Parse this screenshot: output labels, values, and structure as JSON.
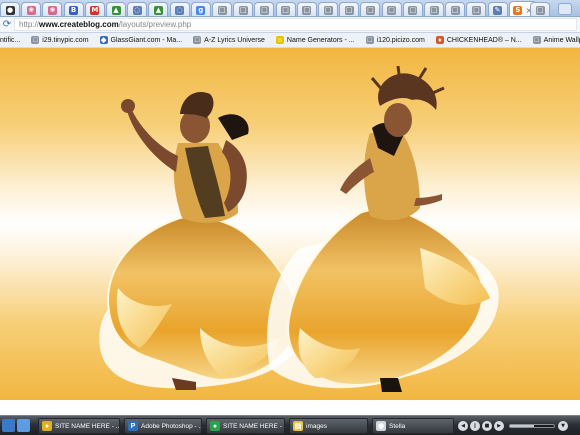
{
  "browser": {
    "tabs": [
      {
        "icon": "favicon-dark-circle",
        "color": "#333333",
        "glyph": "●",
        "active": false
      },
      {
        "icon": "favicon-butterfly",
        "color": "#d96a8b",
        "glyph": "❀",
        "active": false
      },
      {
        "icon": "favicon-butterfly",
        "color": "#d96a8b",
        "glyph": "❀",
        "active": false
      },
      {
        "icon": "favicon-blogger",
        "color": "#3b5fbf",
        "glyph": "B",
        "active": false
      },
      {
        "icon": "favicon-gmail",
        "color": "#d93025",
        "glyph": "M",
        "active": false
      },
      {
        "icon": "favicon-green-leaf",
        "color": "#3a8f3a",
        "glyph": "▲",
        "active": false
      },
      {
        "icon": "favicon-loading",
        "color": "#5b7fb5",
        "glyph": "◌",
        "active": false
      },
      {
        "icon": "favicon-green-leaf",
        "color": "#3a8f3a",
        "glyph": "▲",
        "active": false
      },
      {
        "icon": "favicon-loading",
        "color": "#5b7fb5",
        "glyph": "◌",
        "active": false
      },
      {
        "icon": "favicon-google",
        "color": "#4285f4",
        "glyph": "g",
        "active": false
      },
      {
        "icon": "favicon-page",
        "color": "#8a93a0",
        "glyph": "□",
        "active": false
      },
      {
        "icon": "favicon-page",
        "color": "#8a93a0",
        "glyph": "□",
        "active": false
      },
      {
        "icon": "favicon-page",
        "color": "#8a93a0",
        "glyph": "□",
        "active": false
      },
      {
        "icon": "favicon-page",
        "color": "#8a93a0",
        "glyph": "□",
        "active": false
      },
      {
        "icon": "favicon-page",
        "color": "#8a93a0",
        "glyph": "□",
        "active": false
      },
      {
        "icon": "favicon-page",
        "color": "#8a93a0",
        "glyph": "□",
        "active": false
      },
      {
        "icon": "favicon-page",
        "color": "#8a93a0",
        "glyph": "□",
        "active": false
      },
      {
        "icon": "favicon-page",
        "color": "#8a93a0",
        "glyph": "□",
        "active": false
      },
      {
        "icon": "favicon-page",
        "color": "#8a93a0",
        "glyph": "□",
        "active": false
      },
      {
        "icon": "favicon-page",
        "color": "#8a93a0",
        "glyph": "□",
        "active": false
      },
      {
        "icon": "favicon-page",
        "color": "#8a93a0",
        "glyph": "□",
        "active": false
      },
      {
        "icon": "favicon-page",
        "color": "#8a93a0",
        "glyph": "□",
        "active": false
      },
      {
        "icon": "favicon-page",
        "color": "#8a93a0",
        "glyph": "□",
        "active": false
      },
      {
        "icon": "favicon-edit",
        "color": "#5b7fb5",
        "glyph": "✎",
        "active": false
      },
      {
        "icon": "favicon-createblog",
        "color": "#e07a2a",
        "glyph": "S",
        "active": true
      },
      {
        "icon": "favicon-page",
        "color": "#8a93a0",
        "glyph": "□",
        "active": false
      }
    ],
    "address": {
      "prefix": "http://",
      "domain": "www.createblog.com",
      "path": "/layouts/preview.php"
    },
    "bookmarks": [
      {
        "label": "ntific...",
        "icon": "favicon-none",
        "color": "",
        "glyph": ""
      },
      {
        "label": "i29.tinypic.com",
        "icon": "favicon-page",
        "color": "#8a93a0",
        "glyph": "□"
      },
      {
        "label": "GlassGiant.com - Ma...",
        "icon": "favicon-glassgiant",
        "color": "#3b6db5",
        "glyph": "◆"
      },
      {
        "label": "A-Z Lyrics Universe",
        "icon": "favicon-page",
        "color": "#8a93a0",
        "glyph": "□"
      },
      {
        "label": "Name Generators - ...",
        "icon": "favicon-smiley",
        "color": "#e8c400",
        "glyph": "☺"
      },
      {
        "label": "i120.picizo.com",
        "icon": "favicon-page",
        "color": "#8a93a0",
        "glyph": "□"
      },
      {
        "label": "CHICKENHEAD® – N...",
        "icon": "favicon-chickenhead",
        "color": "#d9582b",
        "glyph": "♦"
      },
      {
        "label": "Anime Wallpapers",
        "icon": "favicon-page",
        "color": "#8a93a0",
        "glyph": "□"
      }
    ]
  },
  "colors": {
    "background_orange": "#f2b640",
    "dress_gold": "#e8a424",
    "taskbar": "#2c3036"
  },
  "taskbar": {
    "quick_launch": [
      {
        "icon": "desktop-icon",
        "color": "#3a78c9"
      },
      {
        "icon": "show-desktop-icon",
        "color": "#5d9be3"
      }
    ],
    "buttons": [
      {
        "label": "SITE NAME HERE - ...",
        "icon": "chrome-icon",
        "color": "#e0b020",
        "glyph": "●"
      },
      {
        "label": "Adobe Photoshop - ...",
        "icon": "photoshop-icon",
        "color": "#2f6fc0",
        "glyph": "P"
      },
      {
        "label": "SITE NAME HERE - ...",
        "icon": "chrome-icon",
        "color": "#2aa34a",
        "glyph": "●"
      },
      {
        "label": "images",
        "icon": "folder-icon",
        "color": "#e6c34a",
        "glyph": "▤"
      },
      {
        "label": "Stella",
        "icon": "user-icon",
        "color": "#cfd6de",
        "glyph": "◉"
      }
    ],
    "media_controls": [
      "prev",
      "play-pause",
      "stop",
      "next"
    ],
    "volume": 0.55
  }
}
